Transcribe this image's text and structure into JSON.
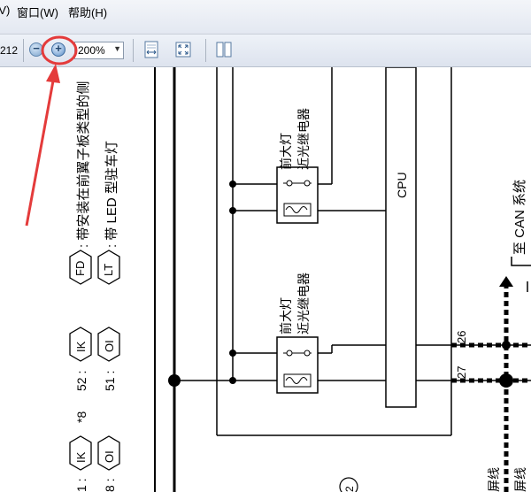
{
  "menubar": {
    "items": [
      {
        "label": "(V)"
      },
      {
        "label": "窗口(W)"
      },
      {
        "label": "帮助(H)"
      }
    ]
  },
  "toolbar": {
    "page_number": "212",
    "zoom_value": "200%",
    "accent_color": "#e43b3b"
  },
  "diagram": {
    "relay_label_line1": "前大灯",
    "relay_label_line2": "近光继电器",
    "cpu_label": "CPU",
    "can_label": "至 CAN 系统",
    "pin_26": "26",
    "pin_27": "27",
    "legend": {
      "fd_code": "FD",
      "fd_desc": ": 带安装在前翼子板类型的侧",
      "lt_code": "LT",
      "lt_desc": ": 带 LED 型驻车灯",
      "ik": "IK",
      "oi": "OI",
      "star": "*8",
      "num52": "52 :",
      "num51": "51 :",
      "num_a": "1 :",
      "num_b": "8 :",
      "circle2": "2",
      "wire1": "屏线",
      "wire2": "屏线"
    }
  }
}
